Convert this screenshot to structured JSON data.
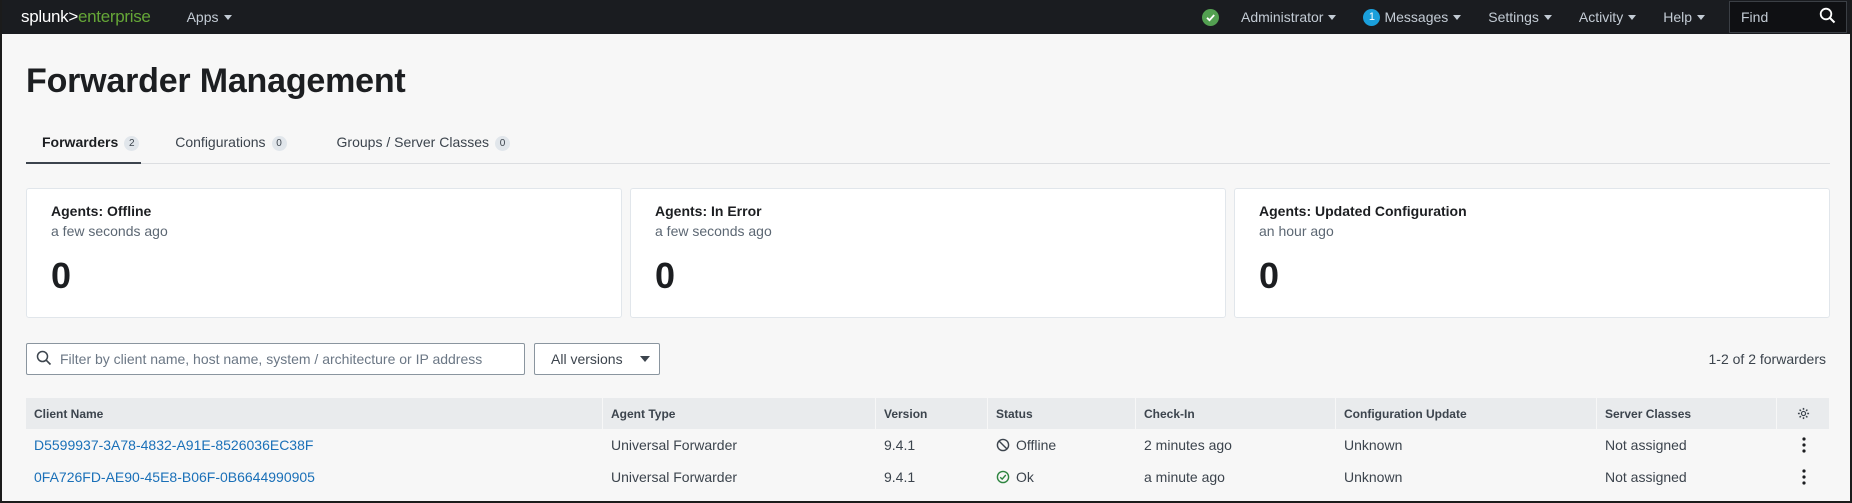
{
  "topbar": {
    "logo_part1": "splunk>",
    "logo_part2": "enterprise",
    "apps_label": "Apps",
    "user_label": "Administrator",
    "messages_count": "1",
    "messages_label": "Messages",
    "settings_label": "Settings",
    "activity_label": "Activity",
    "help_label": "Help",
    "find_placeholder": "Find"
  },
  "page": {
    "title": "Forwarder Management"
  },
  "tabs": [
    {
      "label": "Forwarders",
      "count": "2",
      "active": true
    },
    {
      "label": "Configurations",
      "count": "0",
      "active": false
    },
    {
      "label": "Groups / Server Classes",
      "count": "0",
      "active": false
    }
  ],
  "cards": [
    {
      "title": "Agents: Offline",
      "subtitle": "a few seconds ago",
      "value": "0"
    },
    {
      "title": "Agents: In Error",
      "subtitle": "a few seconds ago",
      "value": "0"
    },
    {
      "title": "Agents: Updated Configuration",
      "subtitle": "an hour ago",
      "value": "0"
    }
  ],
  "filter": {
    "placeholder": "Filter by client name, host name, system / architecture or IP address",
    "versions_label": "All versions",
    "count_text": "1-2 of 2 forwarders"
  },
  "table": {
    "headers": [
      "Client Name",
      "Agent Type",
      "Version",
      "Status",
      "Check-In",
      "Configuration Update",
      "Server Classes"
    ],
    "rows": [
      {
        "client": "D5599937-3A78-4832-A91E-8526036EC38F",
        "agent_type": "Universal Forwarder",
        "version": "9.4.1",
        "status": "Offline",
        "checkin": "2 minutes ago",
        "config_update": "Unknown",
        "server_classes": "Not assigned"
      },
      {
        "client": "0FA726FD-AE90-45E8-B06F-0B6644990905",
        "agent_type": "Universal Forwarder",
        "version": "9.4.1",
        "status": "Ok",
        "checkin": "a minute ago",
        "config_update": "Unknown",
        "server_classes": "Not assigned"
      }
    ]
  },
  "colors": {
    "topbar_bg": "#1a1c20",
    "accent_green": "#65a637",
    "status_ok": "#53a051",
    "link_blue": "#1a70b8",
    "badge_blue": "#1a9fdb"
  }
}
